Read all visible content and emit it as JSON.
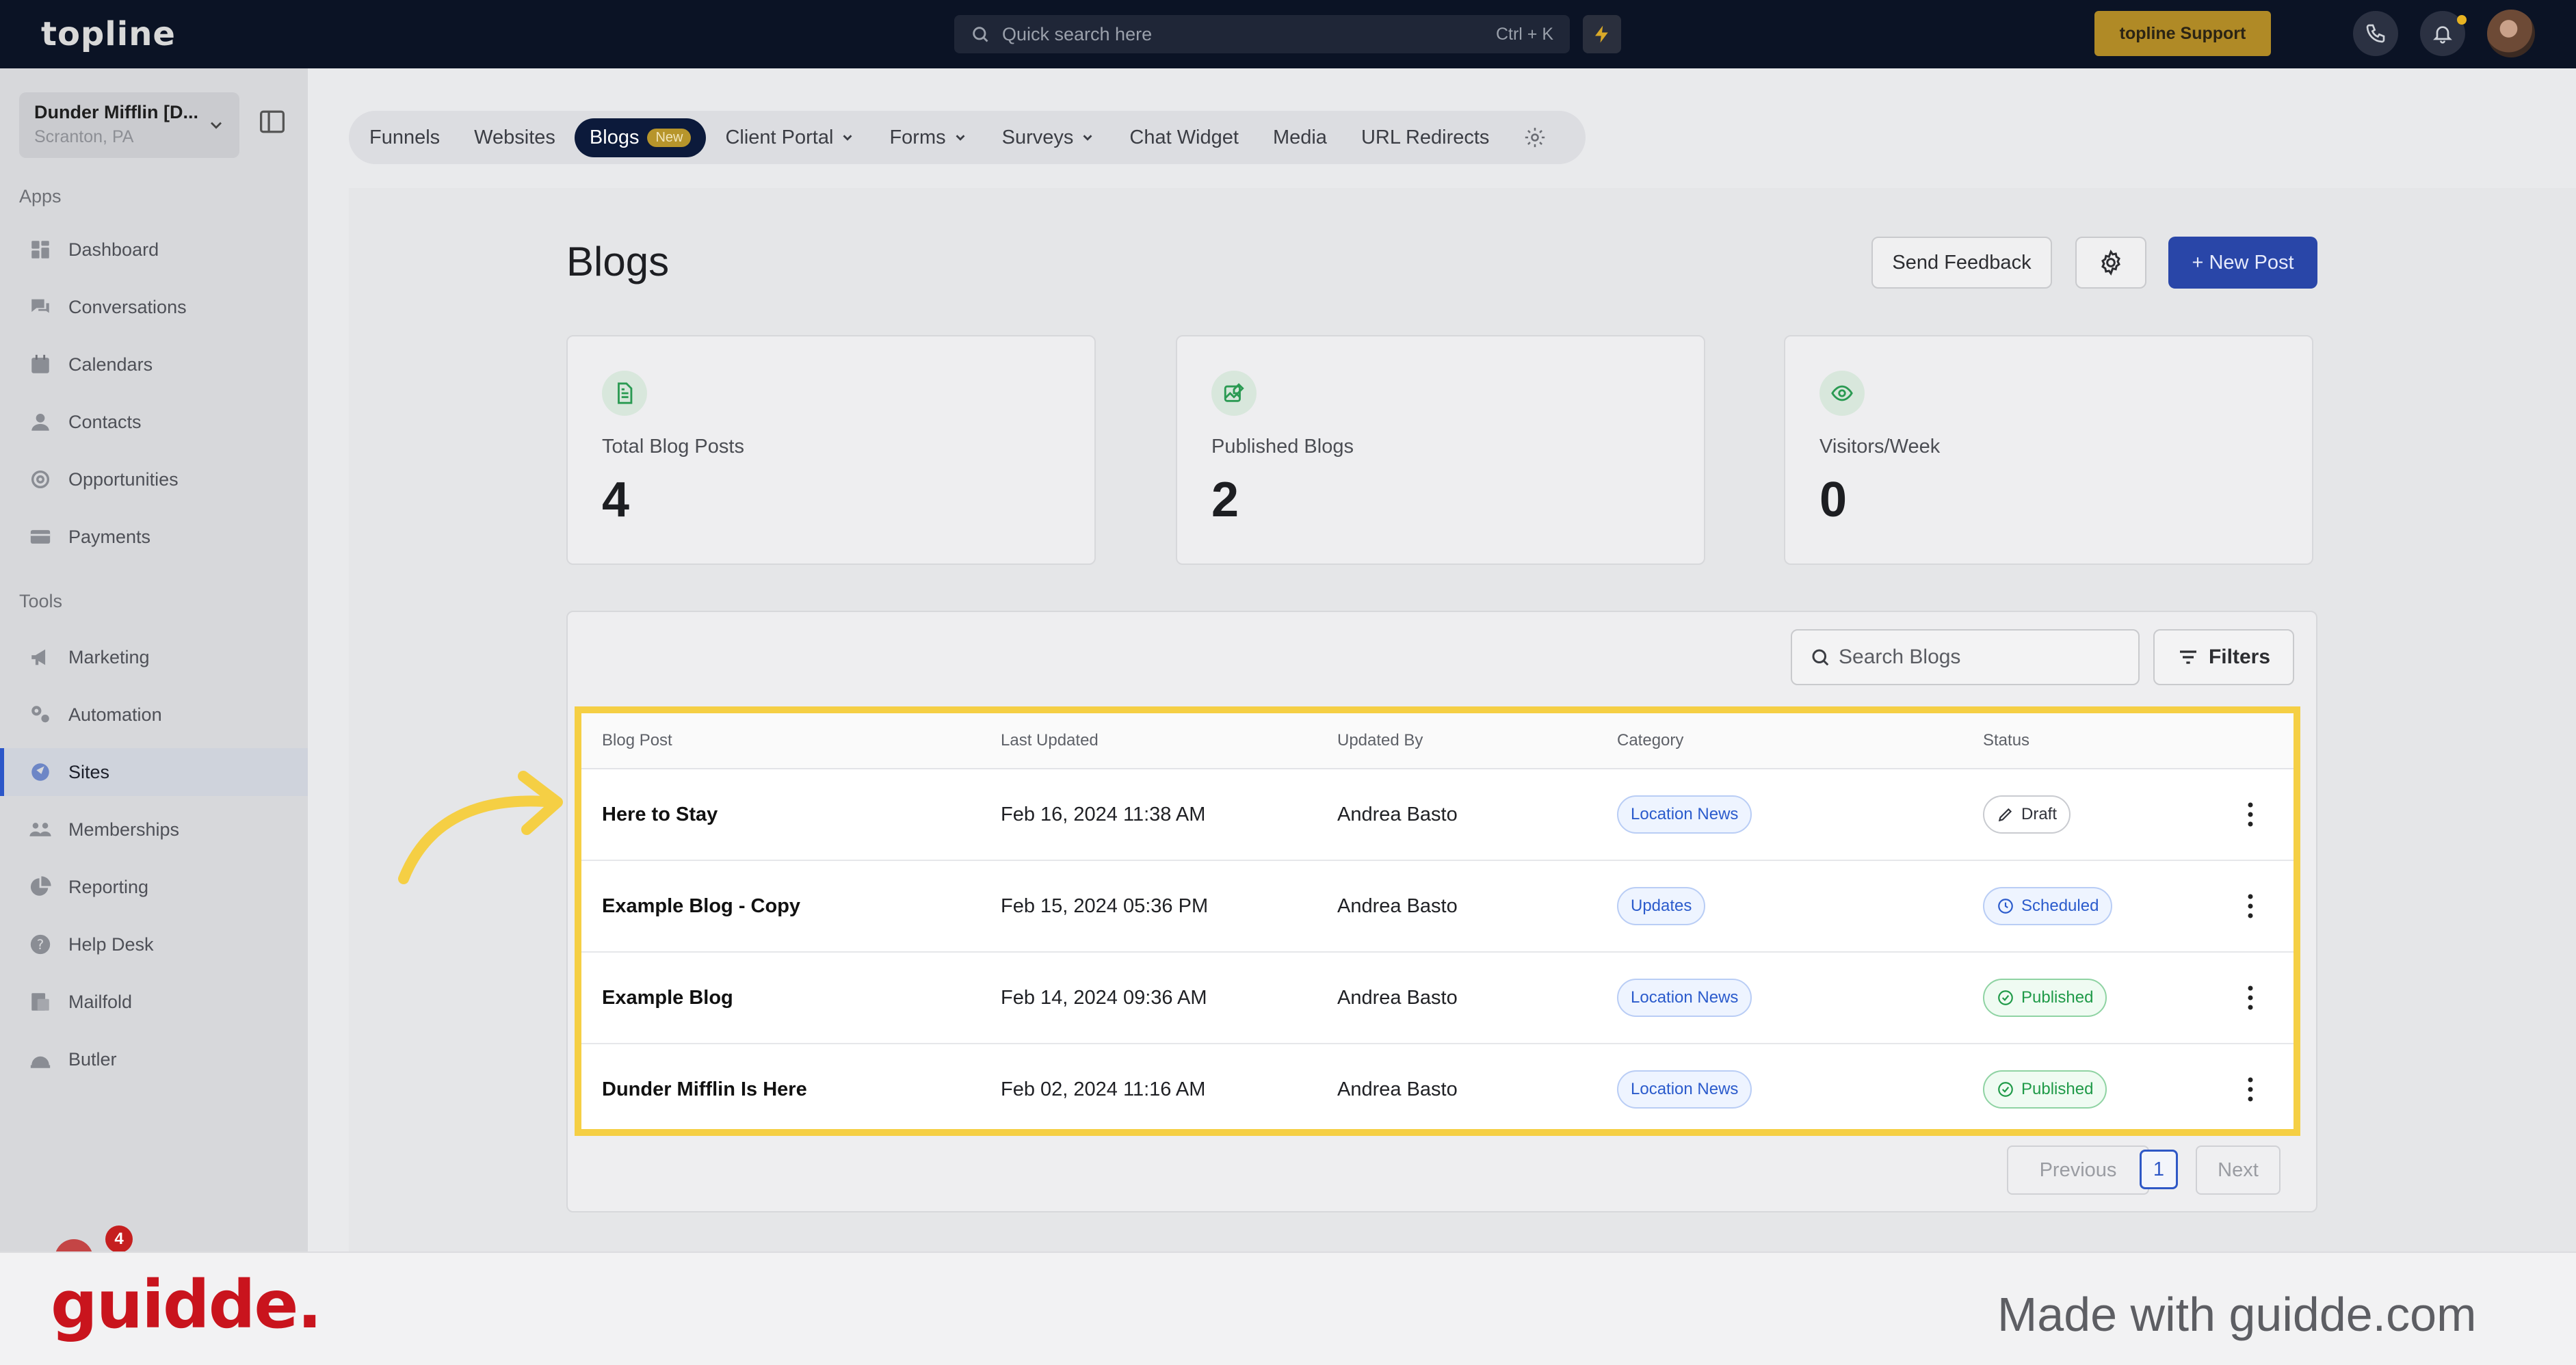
{
  "topbar": {
    "logo": "topline",
    "search_placeholder": "Quick search here",
    "search_shortcut": "Ctrl + K",
    "support_label": "topline Support"
  },
  "sidebar": {
    "location_name": "Dunder Mifflin [D...",
    "location_sub": "Scranton, PA",
    "apps_heading": "Apps",
    "apps": [
      {
        "label": "Dashboard",
        "icon": "dashboard-icon"
      },
      {
        "label": "Conversations",
        "icon": "chat-icon"
      },
      {
        "label": "Calendars",
        "icon": "calendar-icon"
      },
      {
        "label": "Contacts",
        "icon": "person-icon"
      },
      {
        "label": "Opportunities",
        "icon": "target-icon"
      },
      {
        "label": "Payments",
        "icon": "card-icon"
      }
    ],
    "tools_heading": "Tools",
    "tools": [
      {
        "label": "Marketing",
        "icon": "megaphone-icon"
      },
      {
        "label": "Automation",
        "icon": "gears-icon"
      },
      {
        "label": "Sites",
        "icon": "sites-icon",
        "active": true
      },
      {
        "label": "Memberships",
        "icon": "members-icon"
      },
      {
        "label": "Reporting",
        "icon": "pie-icon"
      },
      {
        "label": "Help Desk",
        "icon": "help-icon"
      },
      {
        "label": "Mailfold",
        "icon": "mail-icon"
      },
      {
        "label": "Butler",
        "icon": "butler-icon"
      }
    ],
    "badge_count": "4"
  },
  "nav": {
    "items": [
      "Funnels",
      "Websites",
      "Blogs",
      "Client Portal",
      "Forms",
      "Surveys",
      "Chat Widget",
      "Media",
      "URL Redirects"
    ],
    "active": "Blogs",
    "blogs_badge": "New"
  },
  "page": {
    "title": "Blogs",
    "send_feedback": "Send Feedback",
    "new_post": "+ New Post"
  },
  "stats": [
    {
      "label": "Total Blog Posts",
      "value": "4",
      "icon": "document-icon"
    },
    {
      "label": "Published Blogs",
      "value": "2",
      "icon": "image-edit-icon"
    },
    {
      "label": "Visitors/Week",
      "value": "0",
      "icon": "eye-icon"
    }
  ],
  "table": {
    "search_placeholder": "Search Blogs",
    "filters_label": "Filters",
    "columns": [
      "Blog Post",
      "Last Updated",
      "Updated By",
      "Category",
      "Status"
    ],
    "rows": [
      {
        "title": "Here to Stay",
        "updated": "Feb 16, 2024 11:38 AM",
        "by": "Andrea Basto",
        "category": "Location News",
        "status": "Draft"
      },
      {
        "title": "Example Blog - Copy",
        "updated": "Feb 15, 2024 05:36 PM",
        "by": "Andrea Basto",
        "category": "Updates",
        "status": "Scheduled"
      },
      {
        "title": "Example Blog",
        "updated": "Feb 14, 2024 09:36 AM",
        "by": "Andrea Basto",
        "category": "Location News",
        "status": "Published"
      },
      {
        "title": "Dunder Mifflin Is Here",
        "updated": "Feb 02, 2024 11:16 AM",
        "by": "Andrea Basto",
        "category": "Location News",
        "status": "Published"
      }
    ],
    "pagination": {
      "previous": "Previous",
      "current": "1",
      "next": "Next"
    }
  },
  "colors": {
    "highlight": "#f5cf44",
    "primary": "#2946a8",
    "topbar": "#0b1325",
    "brand_footer": "#c9141d"
  },
  "footer": {
    "logo": "guidde.",
    "made_with": "Made with guidde.com"
  }
}
